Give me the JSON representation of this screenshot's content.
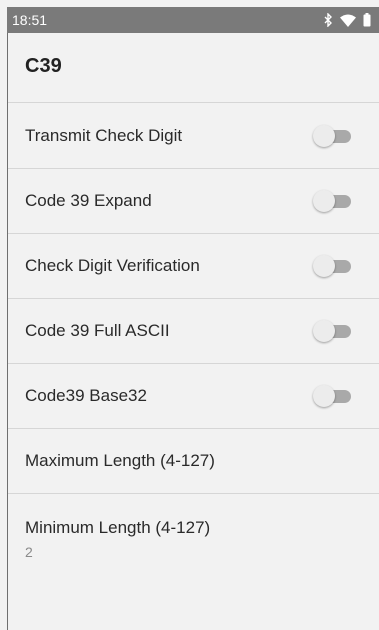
{
  "status_bar": {
    "time": "18:51",
    "icons": [
      "bluetooth-icon",
      "wifi-icon",
      "battery-icon"
    ]
  },
  "app_bar": {
    "title": "C39"
  },
  "settings": [
    {
      "label": "Transmit Check Digit",
      "type": "switch",
      "on": false
    },
    {
      "label": "Code 39 Expand",
      "type": "switch",
      "on": false
    },
    {
      "label": "Check Digit Verification",
      "type": "switch",
      "on": false
    },
    {
      "label": "Code 39 Full ASCII",
      "type": "switch",
      "on": false
    },
    {
      "label": "Code39 Base32",
      "type": "switch",
      "on": false
    },
    {
      "label": "Maximum Length (4-127)",
      "type": "text"
    },
    {
      "label": "Minimum Length (4-127)",
      "type": "text",
      "value": "2"
    }
  ]
}
